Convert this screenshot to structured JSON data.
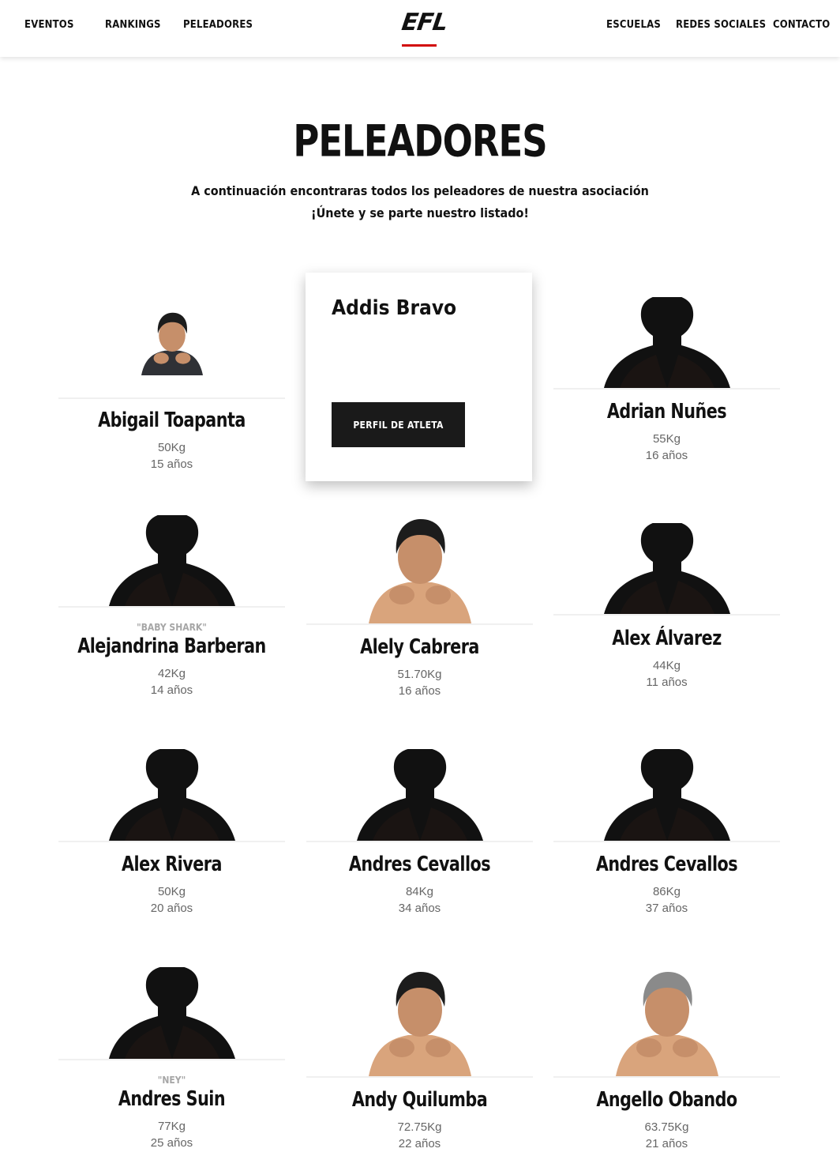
{
  "header": {
    "nav_left": [
      "EVENTOS",
      "RANKINGS",
      "PELEADORES"
    ],
    "logo": "EFL",
    "nav_right": [
      "ESCUELAS",
      "REDES SOCIALES",
      "CONTACTO"
    ]
  },
  "main": {
    "title": "PELEADORES",
    "subtitle_line1": "A continuación encontraras todos los peleadores de nuestra asociación",
    "subtitle_line2": "¡Únete y se parte nuestro listado!"
  },
  "hover_card": {
    "name": "Addis Bravo",
    "button_label": "PERFIL DE ATLETA"
  },
  "fighters": [
    {
      "name": "Abigail Toapanta",
      "nickname": "",
      "weight": "50Kg",
      "age": "15 años",
      "photo": "female-gi-fighter"
    },
    {
      "name": "Adrian Nuñes",
      "nickname": "",
      "weight": "55Kg",
      "age": "16 años",
      "photo": "silhouette"
    },
    {
      "name": "Alejandrina Barberan",
      "nickname": "\"BABY SHARK\"",
      "weight": "42Kg",
      "age": "14 años",
      "photo": "silhouette"
    },
    {
      "name": "Alely Cabrera",
      "nickname": "",
      "weight": "51.70Kg",
      "age": "16 años",
      "photo": "female-fighter"
    },
    {
      "name": "Alex Álvarez",
      "nickname": "",
      "weight": "44Kg",
      "age": "11 años",
      "photo": "silhouette"
    },
    {
      "name": "Alex Rivera",
      "nickname": "",
      "weight": "50Kg",
      "age": "20 años",
      "photo": "silhouette"
    },
    {
      "name": "Andres Cevallos",
      "nickname": "",
      "weight": "84Kg",
      "age": "34 años",
      "photo": "silhouette"
    },
    {
      "name": "Andres Cevallos",
      "nickname": "",
      "weight": "86Kg",
      "age": "37 años",
      "photo": "silhouette"
    },
    {
      "name": "Andres Suin",
      "nickname": "\"NEY\"",
      "weight": "77Kg",
      "age": "25 años",
      "photo": "silhouette"
    },
    {
      "name": "Andy Quilumba",
      "nickname": "",
      "weight": "72.75Kg",
      "age": "22 años",
      "photo": "male-fighter-dark"
    },
    {
      "name": "Angello Obando",
      "nickname": "",
      "weight": "63.75Kg",
      "age": "21 años",
      "photo": "male-fighter-grey"
    }
  ],
  "colors": {
    "accent": "#d20a0a",
    "text": "#111111",
    "muted": "#666666",
    "nickname": "#a6a6a6",
    "button_bg": "#1a1a1a"
  }
}
